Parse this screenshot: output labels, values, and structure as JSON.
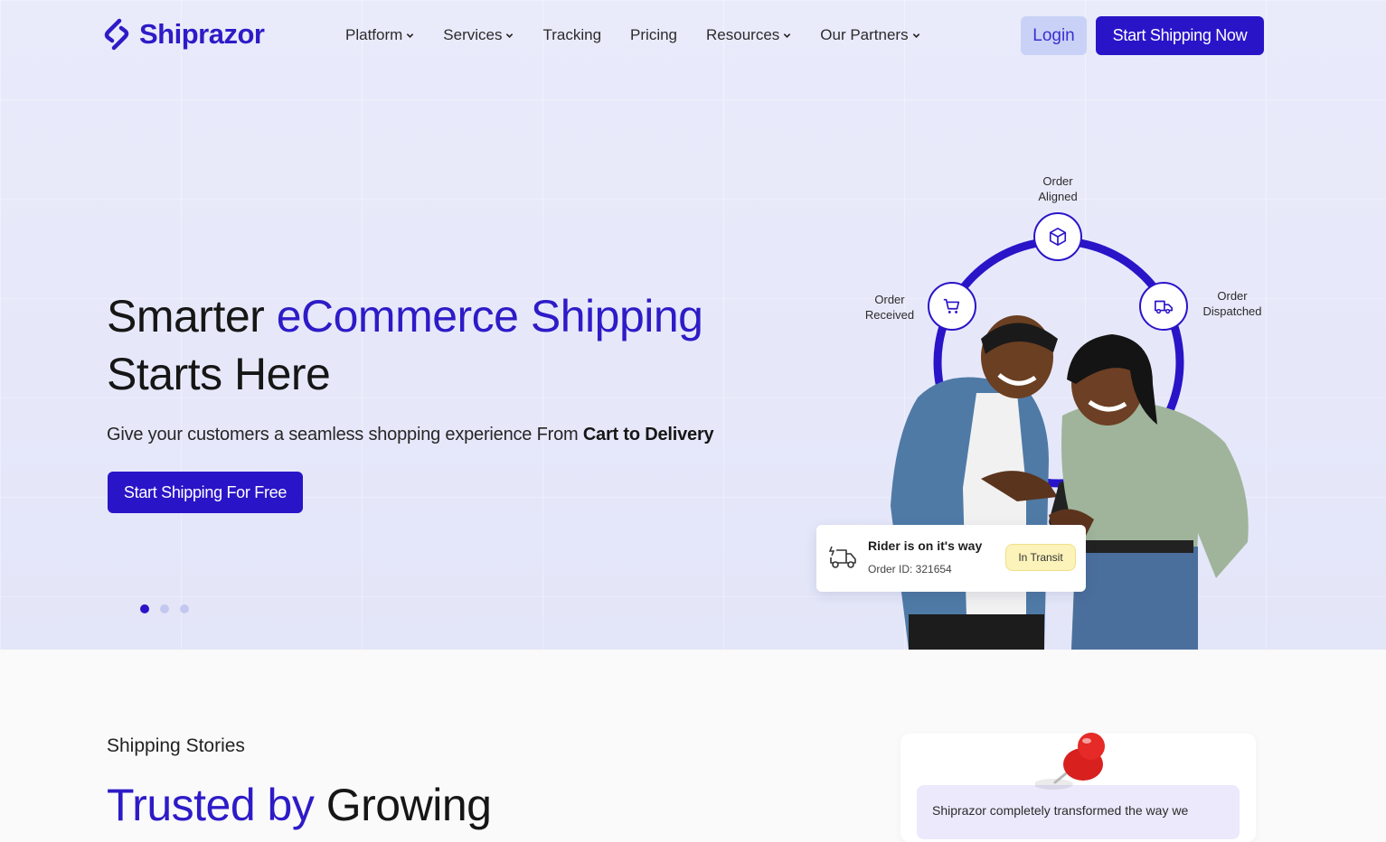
{
  "brand": {
    "name": "Shiprazor",
    "color": "#2e1bc7"
  },
  "nav": {
    "items": [
      {
        "label": "Platform",
        "dropdown": true
      },
      {
        "label": "Services",
        "dropdown": true
      },
      {
        "label": "Tracking",
        "dropdown": false
      },
      {
        "label": "Pricing",
        "dropdown": false
      },
      {
        "label": "Resources",
        "dropdown": true
      },
      {
        "label": "Our Partners",
        "dropdown": true
      }
    ],
    "login_label": "Login",
    "start_label": "Start Shipping Now"
  },
  "hero": {
    "headline_part1": "Smarter ",
    "headline_accent": "eCommerce Shipping",
    "headline_part2": "Starts Here",
    "subline_text": "Give your customers a seamless shopping experience From ",
    "subline_bold": "Cart to Delivery",
    "cta_label": "Start Shipping For Free",
    "carousel": {
      "total": 3,
      "active": 1
    }
  },
  "tracker": {
    "stages": {
      "aligned": {
        "line1": "Order",
        "line2": "Aligned",
        "icon": "box-icon"
      },
      "received": {
        "line1": "Order",
        "line2": "Received",
        "icon": "cart-icon"
      },
      "dispatched": {
        "line1": "Order",
        "line2": "Dispatched",
        "icon": "truck-icon"
      }
    },
    "card": {
      "title": "Rider is on it's way",
      "order_id": "Order ID: 321654",
      "status": "In Transit",
      "icon": "delivery-truck-icon"
    }
  },
  "stories": {
    "label": "Shipping Stories",
    "title_accent": "Trusted by",
    "title_rest": " Growing",
    "quote": "Shiprazor completely transformed the way we"
  },
  "colors": {
    "primary": "#2a14c8",
    "login_bg": "#c9d2f6",
    "badge_bg": "#fbf3b9",
    "hero_bg": "#e7e9fa"
  }
}
